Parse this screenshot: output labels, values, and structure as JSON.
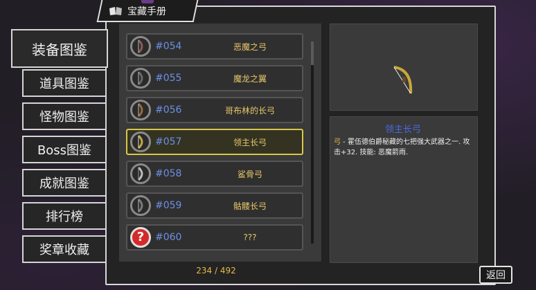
{
  "window": {
    "title": "宝藏手册"
  },
  "nav": [
    {
      "label": "装备图鉴",
      "active": true
    },
    {
      "label": "道具图鉴"
    },
    {
      "label": "怪物图鉴"
    },
    {
      "label": "Boss图鉴"
    },
    {
      "label": "成就图鉴"
    },
    {
      "label": "排行榜"
    },
    {
      "label": "奖章收藏"
    }
  ],
  "items": [
    {
      "id": "#054",
      "name": "恶魔之弓",
      "icon": "bow-icon"
    },
    {
      "id": "#055",
      "name": "魔龙之翼",
      "icon": "bow-icon"
    },
    {
      "id": "#056",
      "name": "哥布林的长弓",
      "icon": "bow-icon"
    },
    {
      "id": "#057",
      "name": "领主长弓",
      "icon": "bow-icon",
      "selected": true
    },
    {
      "id": "#058",
      "name": "鲨骨弓",
      "icon": "bow-icon"
    },
    {
      "id": "#059",
      "name": "骷髅长弓",
      "icon": "bow-icon"
    },
    {
      "id": "#060",
      "name": "???",
      "icon": "question-icon"
    }
  ],
  "counter": "234 / 492",
  "detail": {
    "title": "领主长弓",
    "category": "弓",
    "description": " - 霍伍德伯爵秘藏的七把强大武器之一. 攻击+32. 技能: 恶魔箭雨."
  },
  "back_label": "返回",
  "colors": {
    "id": "#6d8fe6",
    "name": "#e7c76a",
    "selected_border": "#d9c84a",
    "detail_title": "#4a6ae0"
  }
}
